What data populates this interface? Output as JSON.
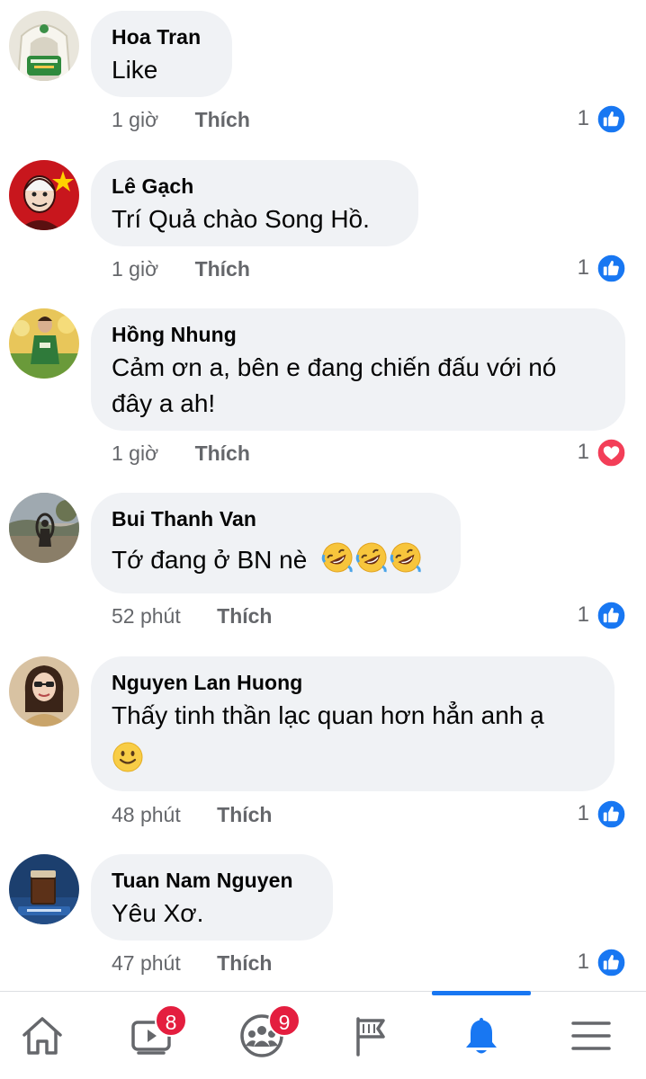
{
  "colors": {
    "bubble": "#f0f2f5",
    "meta_text": "#65676b",
    "like_blue": "#1877f2",
    "love_red": "#f33e58",
    "badge_red": "#e41e3f"
  },
  "comments": [
    {
      "author": "Hoa Tran",
      "lines": [
        "Like"
      ],
      "time": "1 giờ",
      "like_label": "Thích",
      "reaction_count": "1",
      "reaction_icon": "like-icon"
    },
    {
      "author": "Lê Gạch",
      "lines": [
        "Trí Quả chào Song Hồ."
      ],
      "time": "1 giờ",
      "like_label": "Thích",
      "reaction_count": "1",
      "reaction_icon": "like-icon"
    },
    {
      "author": "Hồng Nhung",
      "lines": [
        "Cảm ơn a, bên e đang chiến đấu với nó",
        "đây a ah!"
      ],
      "time": "1 giờ",
      "like_label": "Thích",
      "reaction_count": "1",
      "reaction_icon": "love-icon"
    },
    {
      "author": "Bui Thanh Van",
      "lines": [
        "Tớ đang ở BN nè"
      ],
      "emojis": [
        "rofl-emoji",
        "rofl-emoji",
        "rofl-emoji"
      ],
      "time": "52 phút",
      "like_label": "Thích",
      "reaction_count": "1",
      "reaction_icon": "like-icon"
    },
    {
      "author": "Nguyen Lan Huong",
      "lines": [
        "Thấy tinh thần lạc quan hơn hẳn anh ạ"
      ],
      "emojis": [
        "smile-emoji"
      ],
      "time": "48 phút",
      "like_label": "Thích",
      "reaction_count": "1",
      "reaction_icon": "like-icon"
    },
    {
      "author": "Tuan Nam Nguyen",
      "lines": [
        "Yêu Xơ."
      ],
      "time": "47 phút",
      "like_label": "Thích",
      "reaction_count": "1",
      "reaction_icon": "like-icon"
    }
  ],
  "nav": {
    "items": [
      {
        "icon": "home-icon"
      },
      {
        "icon": "video-icon",
        "badge": "8"
      },
      {
        "icon": "groups-icon",
        "badge": "9"
      },
      {
        "icon": "pages-flag-icon"
      },
      {
        "icon": "notifications-bell-icon",
        "active": true
      },
      {
        "icon": "menu-icon"
      }
    ]
  }
}
